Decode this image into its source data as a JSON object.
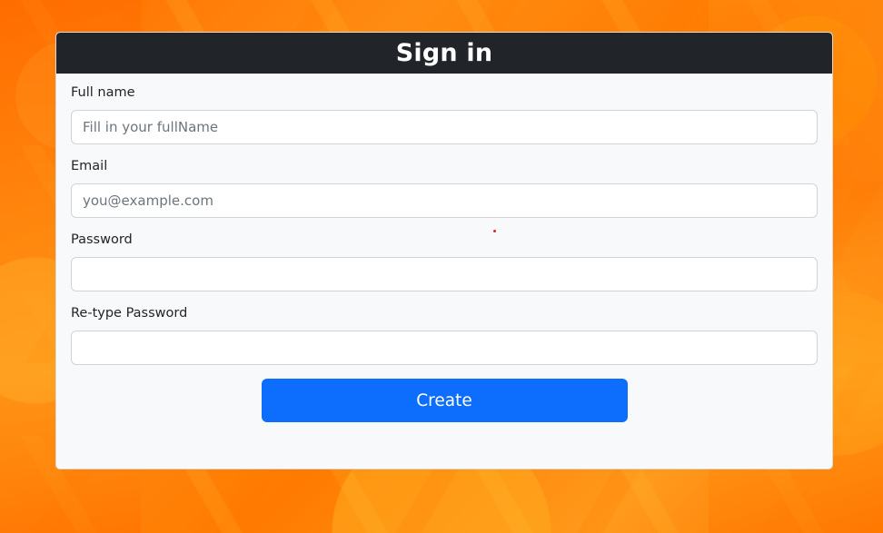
{
  "form": {
    "title": "Sign in",
    "fields": [
      {
        "label": "Full name",
        "placeholder": "Fill in your fullName",
        "value": ""
      },
      {
        "label": "Email",
        "placeholder": "you@example.com",
        "value": ""
      },
      {
        "label": "Password",
        "placeholder": "",
        "value": ""
      },
      {
        "label": "Re-type Password",
        "placeholder": "",
        "value": ""
      }
    ],
    "submit_label": "Create"
  },
  "colors": {
    "header_bg": "#212529",
    "card_bg": "#f8f9fa",
    "primary": "#0d6efd",
    "background_accent": "#ff7a0a"
  }
}
